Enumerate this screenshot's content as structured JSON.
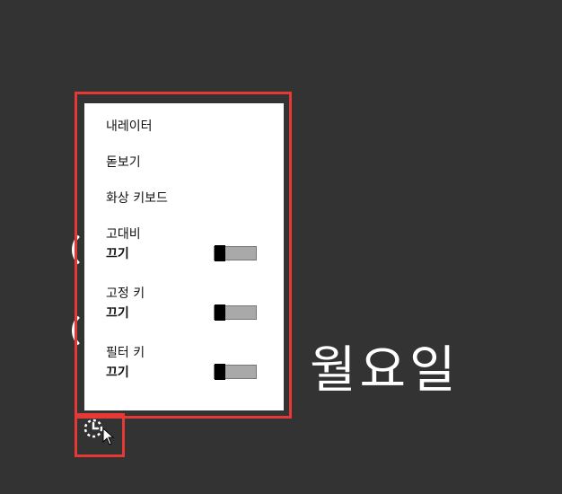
{
  "background": {
    "day_label": "월요일"
  },
  "ease_of_access_menu": {
    "items": [
      {
        "label": "내레이터"
      },
      {
        "label": "돋보기"
      },
      {
        "label": "화상 키보드"
      }
    ],
    "toggles": [
      {
        "title": "고대비",
        "state": "끄기"
      },
      {
        "title": "고정 키",
        "state": "끄기"
      },
      {
        "title": "필터 키",
        "state": "끄기"
      }
    ]
  },
  "colors": {
    "background": "#333333",
    "panel": "#ffffff",
    "highlight": "#e53935"
  },
  "icons": {
    "ease_of_access_button": "ease-of-access-icon",
    "cursor": "mouse-pointer-icon"
  }
}
